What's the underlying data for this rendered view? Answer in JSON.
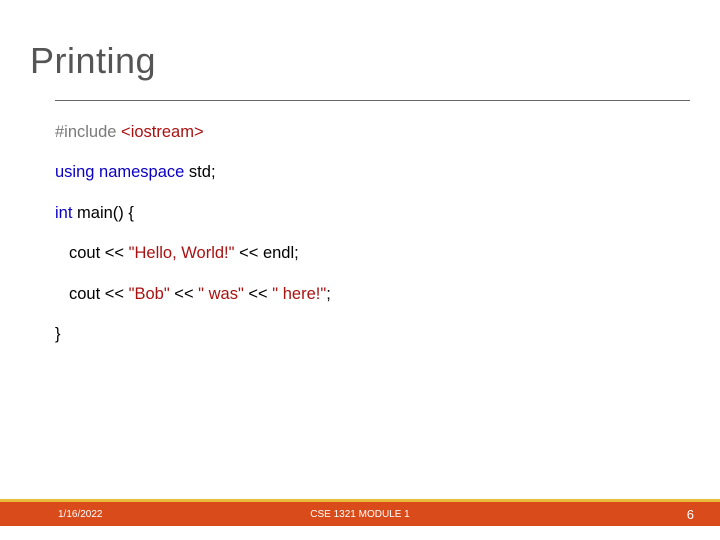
{
  "title": "Printing",
  "code": {
    "line1_a": "#include",
    "line1_b": " <iostream>",
    "line2_a": "using",
    "line2_b": " namespace",
    "line2_c": " std",
    "line2_d": ";",
    "line3_a": "int",
    "line3_b": " main",
    "line3_c": "() {",
    "line4_a": "cout",
    "line4_b": " << ",
    "line4_c": "\"Hello, World!\"",
    "line4_d": " << ",
    "line4_e": "endl",
    "line4_f": ";",
    "line5_a": "cout",
    "line5_b": " << ",
    "line5_c": "\"Bob\"",
    "line5_d": " << ",
    "line5_e": "\" was\"",
    "line5_f": " << ",
    "line5_g": "\" here!\"",
    "line5_h": ";",
    "line6": "}"
  },
  "footer": {
    "date": "1/16/2022",
    "center": "CSE 1321 MODULE 1",
    "page": "6"
  }
}
